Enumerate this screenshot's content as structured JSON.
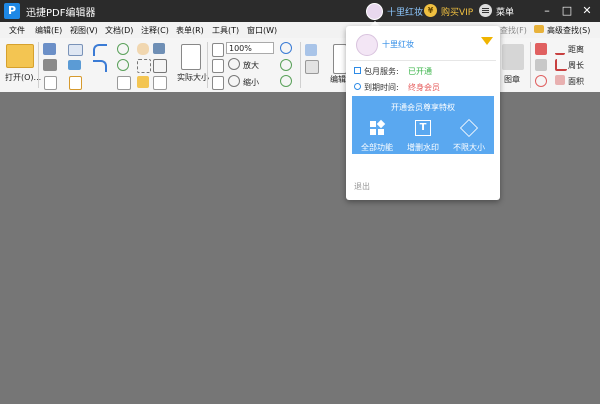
{
  "app": {
    "title": "迅捷PDF编辑器",
    "logo_letter": "P"
  },
  "titlebar": {
    "user_name": "十里红妆",
    "vip_label": "购买VIP",
    "menu_label": "菜单",
    "vip_coin": "¥"
  },
  "menu": [
    "文件",
    "编辑(E)",
    "视图(V)",
    "文档(D)",
    "注释(C)",
    "表单(R)",
    "工具(T)",
    "窗口(W)"
  ],
  "menu_right": {
    "find": "查找(F)",
    "advanced_find": "高级查找(S)"
  },
  "toolbar": {
    "open_label": "打开(O)...",
    "zoom_value": "100%",
    "actual_size": "实际大小",
    "zoom_in": "放大",
    "zoom_out": "缩小",
    "edit_partial": "编辑",
    "stamp": "图章",
    "distance": "距离",
    "perimeter": "周长",
    "area": "面积"
  },
  "popup": {
    "user_name": "十里红妆",
    "monthly_service_label": "包月服务:",
    "monthly_service_value": "已开通",
    "expire_label": "到期时间:",
    "expire_value": "终身会员",
    "vip_title": "开通会员尊享特权",
    "features": [
      "全部功能",
      "增删水印",
      "不限大小"
    ],
    "logout": "退出"
  },
  "colors": {
    "accent": "#2e8be6",
    "vip_panel": "#5aa8f0",
    "active_green": "#3bb44a",
    "lifetime_red": "#e65a5a",
    "gold": "#f0c040"
  }
}
